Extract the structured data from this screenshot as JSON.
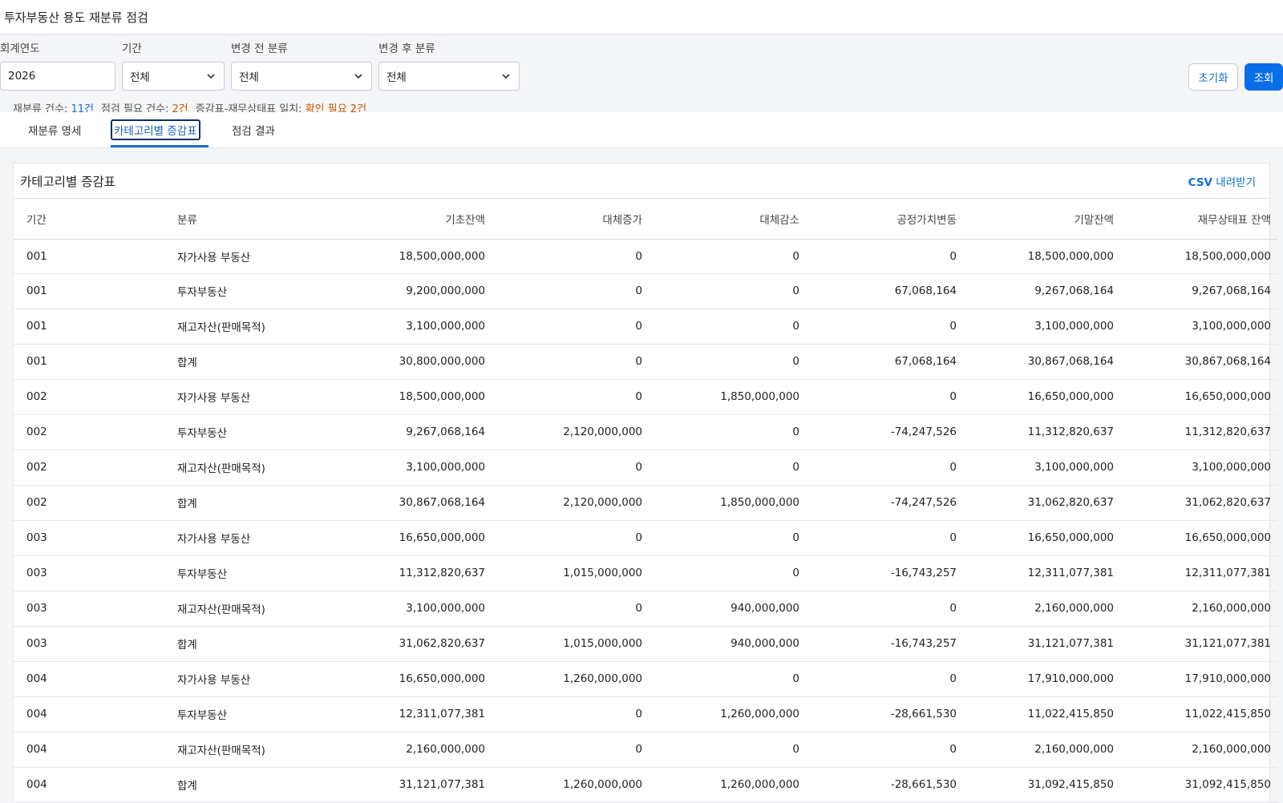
{
  "header": {
    "title": "투자부동산 용도 재분류 점검"
  },
  "filters": {
    "fiscal_year": {
      "label": "회계연도",
      "value": "2026"
    },
    "period": {
      "label": "기간",
      "value": "전체"
    },
    "before_class": {
      "label": "변경 전 분류",
      "value": "전체"
    },
    "after_class": {
      "label": "변경 후 분류",
      "value": "전체"
    }
  },
  "buttons": {
    "reset": "초기화",
    "search": "조회"
  },
  "summary": {
    "reclass_label": "재분류 건수:",
    "reclass_value": "11건",
    "check_label": "점검 필요 건수:",
    "check_value": "2건",
    "match_label": "증감표-재무상태표 일치:",
    "match_value": "확인 필요 2건"
  },
  "tabs": [
    "재분류 명세",
    "카테고리별 증감표",
    "점검 결과"
  ],
  "card": {
    "title": "카테고리별 증감표",
    "csv_bold": "CSV",
    "csv_rest": " 내려받기"
  },
  "table": {
    "columns": [
      "기간",
      "분류",
      "기초잔액",
      "대체증가",
      "대체감소",
      "공정가치변동",
      "기말잔액",
      "재무상태표 잔액"
    ],
    "rows": [
      [
        "001",
        "자가사용 부동산",
        "18,500,000,000",
        "0",
        "0",
        "0",
        "18,500,000,000",
        "18,500,000,000"
      ],
      [
        "001",
        "투자부동산",
        "9,200,000,000",
        "0",
        "0",
        "67,068,164",
        "9,267,068,164",
        "9,267,068,164"
      ],
      [
        "001",
        "재고자산(판매목적)",
        "3,100,000,000",
        "0",
        "0",
        "0",
        "3,100,000,000",
        "3,100,000,000"
      ],
      [
        "001",
        "합계",
        "30,800,000,000",
        "0",
        "0",
        "67,068,164",
        "30,867,068,164",
        "30,867,068,164"
      ],
      [
        "002",
        "자가사용 부동산",
        "18,500,000,000",
        "0",
        "1,850,000,000",
        "0",
        "16,650,000,000",
        "16,650,000,000"
      ],
      [
        "002",
        "투자부동산",
        "9,267,068,164",
        "2,120,000,000",
        "0",
        "-74,247,526",
        "11,312,820,637",
        "11,312,820,637"
      ],
      [
        "002",
        "재고자산(판매목적)",
        "3,100,000,000",
        "0",
        "0",
        "0",
        "3,100,000,000",
        "3,100,000,000"
      ],
      [
        "002",
        "합계",
        "30,867,068,164",
        "2,120,000,000",
        "1,850,000,000",
        "-74,247,526",
        "31,062,820,637",
        "31,062,820,637"
      ],
      [
        "003",
        "자가사용 부동산",
        "16,650,000,000",
        "0",
        "0",
        "0",
        "16,650,000,000",
        "16,650,000,000"
      ],
      [
        "003",
        "투자부동산",
        "11,312,820,637",
        "1,015,000,000",
        "0",
        "-16,743,257",
        "12,311,077,381",
        "12,311,077,381"
      ],
      [
        "003",
        "재고자산(판매목적)",
        "3,100,000,000",
        "0",
        "940,000,000",
        "0",
        "2,160,000,000",
        "2,160,000,000"
      ],
      [
        "003",
        "합계",
        "31,062,820,637",
        "1,015,000,000",
        "940,000,000",
        "-16,743,257",
        "31,121,077,381",
        "31,121,077,381"
      ],
      [
        "004",
        "자가사용 부동산",
        "16,650,000,000",
        "1,260,000,000",
        "0",
        "0",
        "17,910,000,000",
        "17,910,000,000"
      ],
      [
        "004",
        "투자부동산",
        "12,311,077,381",
        "0",
        "1,260,000,000",
        "-28,661,530",
        "11,022,415,850",
        "11,022,415,850"
      ],
      [
        "004",
        "재고자산(판매목적)",
        "2,160,000,000",
        "0",
        "0",
        "0",
        "2,160,000,000",
        "2,160,000,000"
      ],
      [
        "004",
        "합계",
        "31,121,077,381",
        "1,260,000,000",
        "1,260,000,000",
        "-28,661,530",
        "31,092,415,850",
        "31,092,415,850"
      ]
    ]
  }
}
